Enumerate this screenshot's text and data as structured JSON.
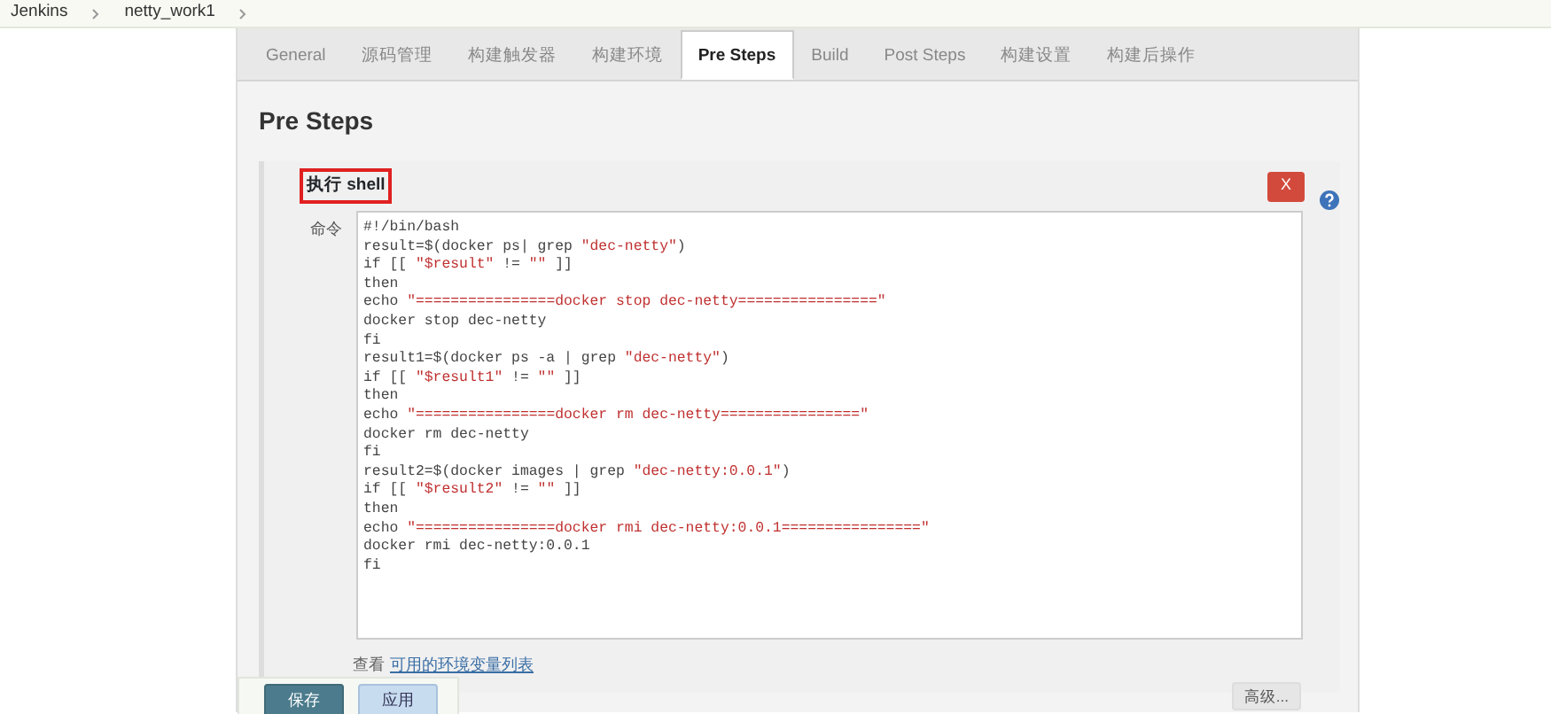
{
  "breadcrumbs": [
    "Jenkins",
    "netty_work1"
  ],
  "tabs": [
    {
      "label": "General",
      "selected": false
    },
    {
      "label": "源码管理",
      "selected": false
    },
    {
      "label": "构建触发器",
      "selected": false
    },
    {
      "label": "构建环境",
      "selected": false
    },
    {
      "label": "Pre Steps",
      "selected": true
    },
    {
      "label": "Build",
      "selected": false
    },
    {
      "label": "Post Steps",
      "selected": false
    },
    {
      "label": "构建设置",
      "selected": false
    },
    {
      "label": "构建后操作",
      "selected": false
    }
  ],
  "section_title": "Pre Steps",
  "step": {
    "title": "执行 shell",
    "delete_label": "X",
    "field_label": "命令",
    "code": [
      "#!/bin/bash",
      "result=$(docker ps| grep \"dec-netty\")",
      "if [[ \"$result\" != \"\" ]]",
      "then",
      "echo \"================docker stop dec-netty================\"",
      "docker stop dec-netty",
      "fi",
      "result1=$(docker ps -a | grep \"dec-netty\")",
      "if [[ \"$result1\" != \"\" ]]",
      "then",
      "echo \"================docker rm dec-netty================\"",
      "docker rm dec-netty",
      "fi",
      "result2=$(docker images | grep \"dec-netty:0.0.1\")",
      "if [[ \"$result2\" != \"\" ]]",
      "then",
      "echo \"================docker rmi dec-netty:0.0.1================\"",
      "docker rmi dec-netty:0.0.1",
      "fi"
    ],
    "env_prefix": "查看",
    "env_link": "可用的环境变量列表",
    "advanced": "高级..."
  },
  "buttons": [
    {
      "label": "保存",
      "kind": "primary"
    },
    {
      "label": "应用",
      "kind": "secondary"
    }
  ]
}
